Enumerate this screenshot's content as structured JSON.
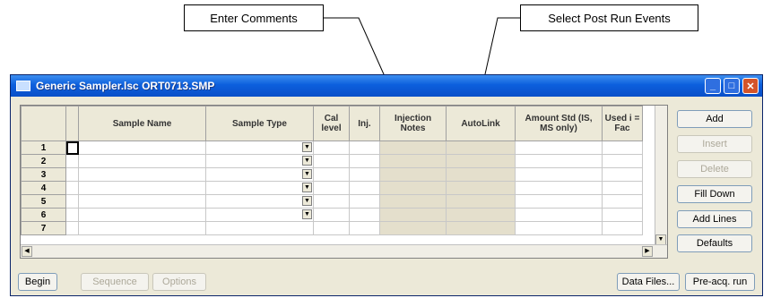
{
  "callouts": {
    "comments": "Enter Comments",
    "post_run": "Select Post Run Events"
  },
  "window": {
    "title": "Generic Sampler.lsc  ORT0713.SMP",
    "minimize": "_",
    "maximize": "□",
    "close": "✕"
  },
  "grid": {
    "columns": [
      {
        "label": ""
      },
      {
        "label": ""
      },
      {
        "label": "Sample Name"
      },
      {
        "label": "Sample Type"
      },
      {
        "label": "Cal level"
      },
      {
        "label": "Inj."
      },
      {
        "label": "Injection Notes"
      },
      {
        "label": "AutoLink"
      },
      {
        "label": "Amount Std (IS, MS only)"
      },
      {
        "label": "Used i = Fac"
      }
    ],
    "rows": [
      "1",
      "2",
      "3",
      "4",
      "5",
      "6",
      "7"
    ],
    "dropdown_glyph": "▼"
  },
  "side_buttons": [
    {
      "label": "Add",
      "enabled": true
    },
    {
      "label": "Insert",
      "enabled": false
    },
    {
      "label": "Delete",
      "enabled": false
    },
    {
      "label": "Fill Down",
      "enabled": true
    },
    {
      "label": "Add Lines",
      "enabled": true
    },
    {
      "label": "Defaults",
      "enabled": true
    }
  ],
  "bottom_buttons": {
    "begin": "Begin",
    "btn2": "Sequence",
    "btn3": "Options",
    "data_files": "Data Files...",
    "pre_run": "Pre-acq. run"
  },
  "icons": {
    "app": "app-window-icon",
    "dropdown": "dropdown-arrow-icon"
  },
  "colors": {
    "titlebar": "#0c5fdd",
    "window_bg": "#ece9d8",
    "close": "#d4542a"
  }
}
